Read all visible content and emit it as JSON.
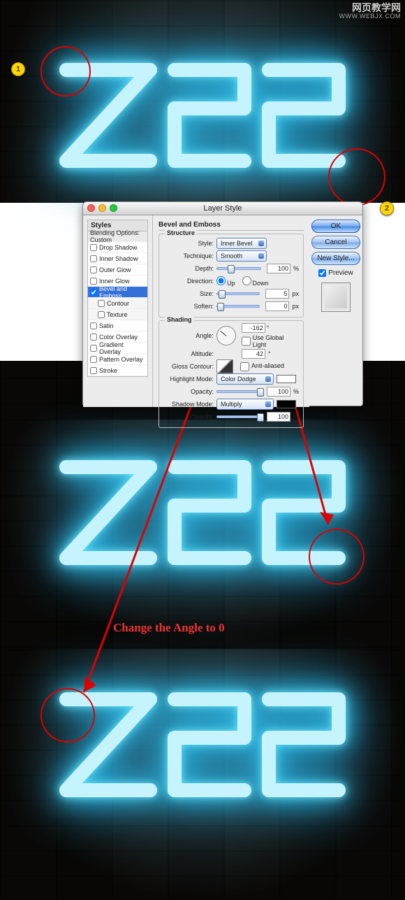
{
  "watermark": {
    "line1": "网页教学网",
    "line2": "WWW.WEBJX.COM"
  },
  "badges": {
    "one": "1",
    "two": "2"
  },
  "annotation": {
    "change_angle": "Change the Angle to 0"
  },
  "dialog": {
    "title": "Layer Style",
    "styles_header": "Styles",
    "blending_options": "Blending Options: Custom",
    "items": [
      {
        "label": "Drop Shadow",
        "checked": false
      },
      {
        "label": "Inner Shadow",
        "checked": false
      },
      {
        "label": "Outer Glow",
        "checked": false
      },
      {
        "label": "Inner Glow",
        "checked": false
      },
      {
        "label": "Bevel and Emboss",
        "checked": true,
        "selected": true
      },
      {
        "label": "Contour",
        "checked": false,
        "sub": true
      },
      {
        "label": "Texture",
        "checked": false,
        "sub": true
      },
      {
        "label": "Satin",
        "checked": false
      },
      {
        "label": "Color Overlay",
        "checked": false
      },
      {
        "label": "Gradient Overlay",
        "checked": false
      },
      {
        "label": "Pattern Overlay",
        "checked": false
      },
      {
        "label": "Stroke",
        "checked": false
      }
    ],
    "panel_title": "Bevel and Emboss",
    "structure_title": "Structure",
    "style_label": "Style:",
    "style_value": "Inner Bevel",
    "technique_label": "Technique:",
    "technique_value": "Smooth",
    "depth_label": "Depth:",
    "depth_value": "100",
    "depth_unit": "%",
    "direction_label": "Direction:",
    "dir_up": "Up",
    "dir_down": "Down",
    "size_label": "Size:",
    "size_value": "5",
    "size_unit": "px",
    "soften_label": "Soften:",
    "soften_value": "0",
    "soften_unit": "px",
    "shading_title": "Shading",
    "angle_label": "Angle:",
    "angle_value": "-162",
    "angle_unit": "°",
    "global_light": "Use Global Light",
    "altitude_label": "Altitude:",
    "altitude_value": "42",
    "altitude_unit": "°",
    "gloss_label": "Gloss Contour:",
    "antialiased": "Anti-aliased",
    "highlight_mode_label": "Highlight Mode:",
    "highlight_mode_value": "Color Dodge",
    "highlight_opacity_label": "Opacity:",
    "highlight_opacity_value": "100",
    "highlight_opacity_unit": "%",
    "shadow_mode_label": "Shadow Mode:",
    "shadow_mode_value": "Multiply",
    "shadow_opacity_label": "Opacity:",
    "shadow_opacity_value": "100",
    "shadow_opacity_unit": "%",
    "ok": "OK",
    "cancel": "Cancel",
    "new_style": "New Style...",
    "preview": "Preview"
  }
}
